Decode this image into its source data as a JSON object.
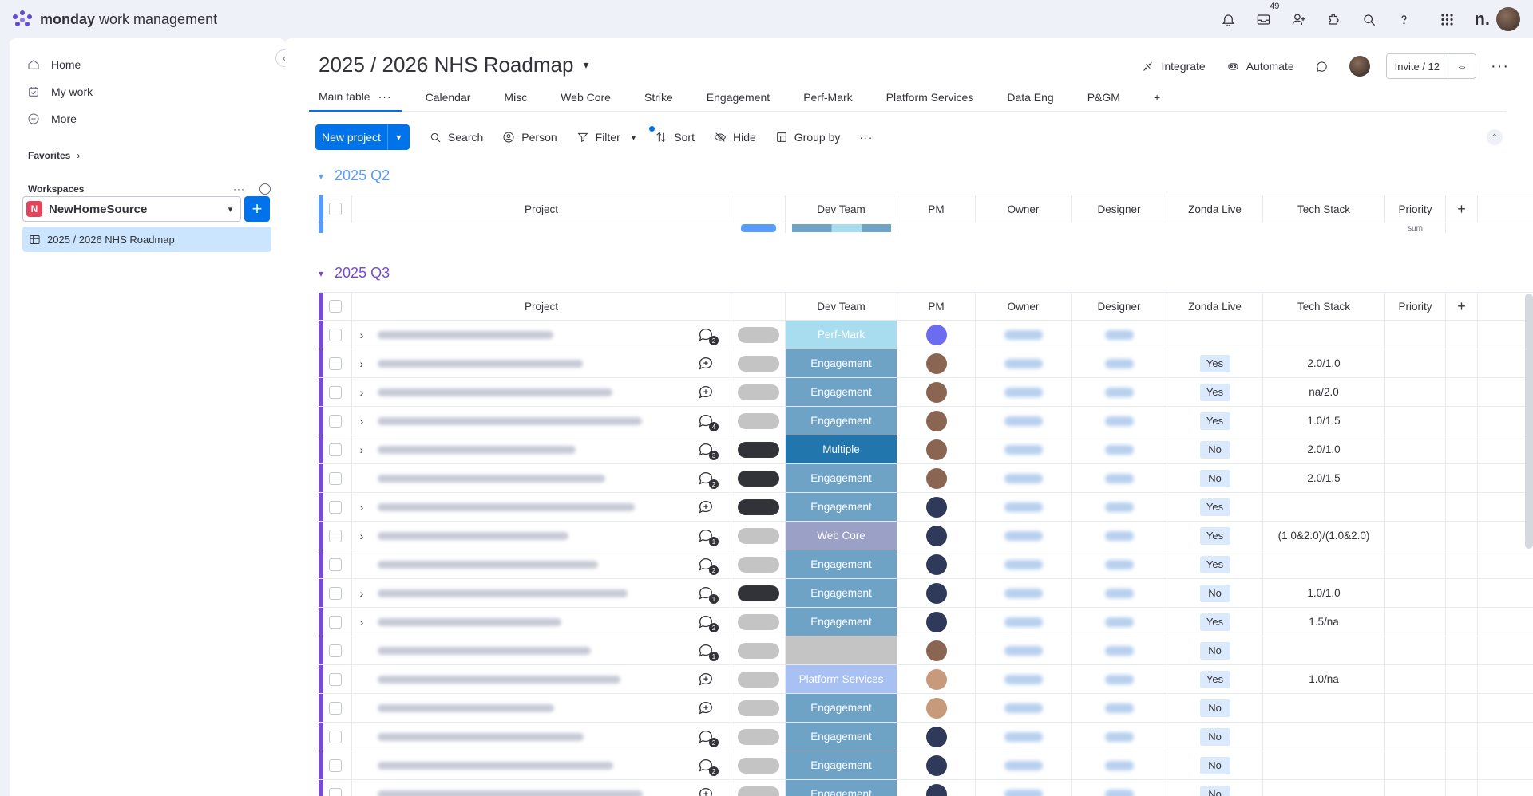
{
  "app": {
    "logo_bold": "monday",
    "logo_rest": " work management",
    "inbox_count": "49",
    "brand_mark": "n."
  },
  "sidebar": {
    "items": [
      {
        "label": "Home",
        "icon": "home-icon"
      },
      {
        "label": "My work",
        "icon": "calendar-check-icon"
      },
      {
        "label": "More",
        "icon": "more-circle-icon"
      }
    ],
    "favorites_label": "Favorites",
    "workspaces_label": "Workspaces",
    "workspace_initial": "N",
    "workspace_name": "NewHomeSource",
    "board_name": "2025 / 2026 NHS Roadmap"
  },
  "board": {
    "title": "2025 / 2026 NHS Roadmap",
    "integrate": "Integrate",
    "automate": "Automate",
    "invite": "Invite / 12"
  },
  "tabs": [
    "Main table",
    "Calendar",
    "Misc",
    "Web Core",
    "Strike",
    "Engagement",
    "Perf-Mark",
    "Platform Services",
    "Data Eng",
    "P&GM"
  ],
  "toolbar": {
    "new_project": "New project",
    "search": "Search",
    "person": "Person",
    "filter": "Filter",
    "sort": "Sort",
    "hide": "Hide",
    "group_by": "Group by"
  },
  "columns": {
    "project": "Project",
    "dev_team": "Dev Team",
    "pm": "PM",
    "owner": "Owner",
    "designer": "Designer",
    "zonda_live": "Zonda Live",
    "tech_stack": "Tech Stack",
    "priority": "Priority"
  },
  "groups": {
    "q2": {
      "title": "2025 Q2",
      "footer_sum": "sum"
    },
    "q3": {
      "title": "2025 Q3"
    }
  },
  "colors": {
    "q2": "#579bfc",
    "q3": "#784bd1",
    "engagement": "#6fa3c6",
    "multiple": "#2176ad",
    "web_core": "#9aa0c6",
    "perf_mark": "#a8ddf0",
    "platform_services": "#a9c0f2"
  },
  "rows": [
    {
      "expand": true,
      "updates": "2",
      "status": "light",
      "team": "Perf-Mark",
      "team_color": "#a8ddf0",
      "pm": "purple",
      "zonda": "",
      "tech": ""
    },
    {
      "expand": true,
      "updates": "",
      "status": "light",
      "team": "Engagement",
      "team_color": "#6fa3c6",
      "pm": "brown",
      "zonda": "Yes",
      "tech": "2.0/1.0"
    },
    {
      "expand": true,
      "updates": "",
      "status": "light",
      "team": "Engagement",
      "team_color": "#6fa3c6",
      "pm": "brown",
      "zonda": "Yes",
      "tech": "na/2.0"
    },
    {
      "expand": true,
      "updates": "4",
      "status": "light",
      "team": "Engagement",
      "team_color": "#6fa3c6",
      "pm": "brown",
      "zonda": "Yes",
      "tech": "1.0/1.5"
    },
    {
      "expand": true,
      "updates": "3",
      "status": "dark",
      "team": "Multiple",
      "team_color": "#2176ad",
      "pm": "brown",
      "zonda": "No",
      "tech": "2.0/1.0"
    },
    {
      "expand": false,
      "updates": "2",
      "status": "dark",
      "team": "Engagement",
      "team_color": "#6fa3c6",
      "pm": "brown",
      "zonda": "No",
      "tech": "2.0/1.5"
    },
    {
      "expand": true,
      "updates": "",
      "status": "dark",
      "team": "Engagement",
      "team_color": "#6fa3c6",
      "pm": "navy",
      "zonda": "Yes",
      "tech": ""
    },
    {
      "expand": true,
      "updates": "1",
      "status": "light",
      "team": "Web Core",
      "team_color": "#9aa0c6",
      "pm": "navy",
      "zonda": "Yes",
      "tech": "(1.0&2.0)/(1.0&2.0)"
    },
    {
      "expand": false,
      "updates": "2",
      "status": "light",
      "team": "Engagement",
      "team_color": "#6fa3c6",
      "pm": "navy",
      "zonda": "Yes",
      "tech": ""
    },
    {
      "expand": true,
      "updates": "1",
      "status": "dark",
      "team": "Engagement",
      "team_color": "#6fa3c6",
      "pm": "navy",
      "zonda": "No",
      "tech": "1.0/1.0"
    },
    {
      "expand": true,
      "updates": "2",
      "status": "light",
      "team": "Engagement",
      "team_color": "#6fa3c6",
      "pm": "navy",
      "zonda": "Yes",
      "tech": "1.5/na"
    },
    {
      "expand": false,
      "updates": "1",
      "status": "light",
      "team": "",
      "team_color": "#c4c4c4",
      "pm": "brown",
      "zonda": "No",
      "tech": ""
    },
    {
      "expand": false,
      "updates": "",
      "status": "light",
      "team": "Platform Services",
      "team_color": "#a9c0f2",
      "pm": "tan",
      "zonda": "Yes",
      "tech": "1.0/na"
    },
    {
      "expand": false,
      "updates": "",
      "status": "light",
      "team": "Engagement",
      "team_color": "#6fa3c6",
      "pm": "tan",
      "zonda": "No",
      "tech": ""
    },
    {
      "expand": false,
      "updates": "2",
      "status": "light",
      "team": "Engagement",
      "team_color": "#6fa3c6",
      "pm": "navy",
      "zonda": "No",
      "tech": ""
    },
    {
      "expand": false,
      "updates": "2",
      "status": "light",
      "team": "Engagement",
      "team_color": "#6fa3c6",
      "pm": "navy",
      "zonda": "No",
      "tech": ""
    },
    {
      "expand": false,
      "updates": "",
      "status": "light",
      "team": "Engagement",
      "team_color": "#6fa3c6",
      "pm": "navy",
      "zonda": "No",
      "tech": ""
    }
  ]
}
